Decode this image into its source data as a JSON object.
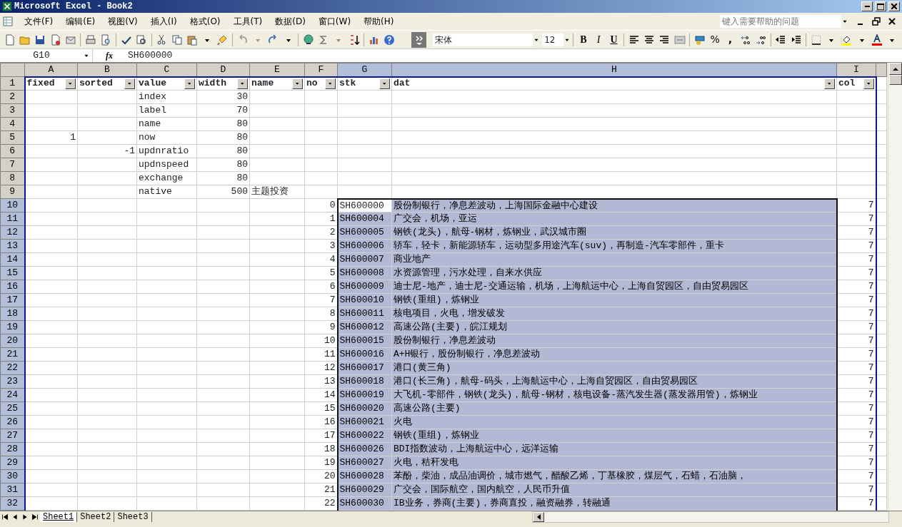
{
  "window": {
    "title": "Microsoft Excel - Book2"
  },
  "menu": [
    "文件(F)",
    "编辑(E)",
    "视图(V)",
    "插入(I)",
    "格式(O)",
    "工具(T)",
    "数据(D)",
    "窗口(W)",
    "帮助(H)"
  ],
  "help_box": {
    "placeholder": "键入需要帮助的问题"
  },
  "formatting": {
    "font": "宋体",
    "size": "12",
    "bold": "B",
    "italic": "I",
    "underline": "U",
    "percent": "%",
    "comma": ","
  },
  "formula_bar": {
    "name_box": "G10",
    "fx": "fx",
    "value": "SH600000"
  },
  "columns": [
    {
      "label": "A",
      "selected": false
    },
    {
      "label": "B",
      "selected": false
    },
    {
      "label": "C",
      "selected": false
    },
    {
      "label": "D",
      "selected": false
    },
    {
      "label": "E",
      "selected": false
    },
    {
      "label": "F",
      "selected": false
    },
    {
      "label": "G",
      "selected": true
    },
    {
      "label": "H",
      "selected": true
    },
    {
      "label": "I",
      "selected": false
    }
  ],
  "header_row": {
    "header": "1",
    "selected": false,
    "filters": [
      "fixed",
      "sorted",
      "value",
      "width",
      "name",
      "no",
      "stk",
      "dat",
      "col"
    ]
  },
  "rows": [
    {
      "header": "2",
      "selected": false,
      "cells": {
        "C": "index",
        "D": "30"
      }
    },
    {
      "header": "3",
      "selected": false,
      "cells": {
        "C": "label",
        "D": "70"
      }
    },
    {
      "header": "4",
      "selected": false,
      "cells": {
        "C": "name",
        "D": "80"
      }
    },
    {
      "header": "5",
      "selected": false,
      "cells": {
        "A": "1",
        "C": "now",
        "D": "80"
      }
    },
    {
      "header": "6",
      "selected": false,
      "cells": {
        "B": "-1",
        "C": "updnratio",
        "D": "80"
      }
    },
    {
      "header": "7",
      "selected": false,
      "cells": {
        "C": "updnspeed",
        "D": "80"
      }
    },
    {
      "header": "8",
      "selected": false,
      "cells": {
        "C": "exchange",
        "D": "80"
      }
    },
    {
      "header": "9",
      "selected": false,
      "cells": {
        "C": "native",
        "D": "500",
        "E": "主题投资"
      }
    },
    {
      "header": "10",
      "selected": true,
      "cells": {
        "F": "0",
        "G": "SH600000",
        "H": "股份制银行，净息差波动，上海国际金融中心建设",
        "I": "7"
      }
    },
    {
      "header": "11",
      "selected": true,
      "cells": {
        "F": "1",
        "G": "SH600004",
        "H": "广交会，机场，亚运",
        "I": "7"
      }
    },
    {
      "header": "12",
      "selected": true,
      "cells": {
        "F": "2",
        "G": "SH600005",
        "H": "钢铁(龙头)，航母-钢材，炼钢业，武汉城市圈",
        "I": "7"
      }
    },
    {
      "header": "13",
      "selected": true,
      "cells": {
        "F": "3",
        "G": "SH600006",
        "H": "轿车，轻卡，新能源轿车，运动型多用途汽车(suv)，再制造-汽车零部件，重卡",
        "I": "7"
      }
    },
    {
      "header": "14",
      "selected": true,
      "cells": {
        "F": "4",
        "G": "SH600007",
        "H": "商业地产",
        "I": "7"
      }
    },
    {
      "header": "15",
      "selected": true,
      "cells": {
        "F": "5",
        "G": "SH600008",
        "H": "水资源管理，污水处理，自来水供应",
        "I": "7"
      }
    },
    {
      "header": "16",
      "selected": true,
      "cells": {
        "F": "6",
        "G": "SH600009",
        "H": "迪士尼-地产，迪士尼-交通运输，机场，上海航运中心，上海自贸园区，自由贸易园区",
        "I": "7"
      }
    },
    {
      "header": "17",
      "selected": true,
      "cells": {
        "F": "7",
        "G": "SH600010",
        "H": "钢铁(重组)，炼钢业",
        "I": "7"
      }
    },
    {
      "header": "18",
      "selected": true,
      "cells": {
        "F": "8",
        "G": "SH600011",
        "H": "核电项目，火电，增发破发",
        "I": "7"
      }
    },
    {
      "header": "19",
      "selected": true,
      "cells": {
        "F": "9",
        "G": "SH600012",
        "H": "高速公路(主要)，皖江规划",
        "I": "7"
      }
    },
    {
      "header": "20",
      "selected": true,
      "cells": {
        "F": "10",
        "G": "SH600015",
        "H": "股份制银行，净息差波动",
        "I": "7"
      }
    },
    {
      "header": "21",
      "selected": true,
      "cells": {
        "F": "11",
        "G": "SH600016",
        "H": "A+H银行，股份制银行，净息差波动",
        "I": "7"
      }
    },
    {
      "header": "22",
      "selected": true,
      "cells": {
        "F": "12",
        "G": "SH600017",
        "H": "港口(黄三角)",
        "I": "7"
      }
    },
    {
      "header": "23",
      "selected": true,
      "cells": {
        "F": "13",
        "G": "SH600018",
        "H": "港口(长三角)，航母-码头，上海航运中心，上海自贸园区，自由贸易园区",
        "I": "7"
      }
    },
    {
      "header": "24",
      "selected": true,
      "cells": {
        "F": "14",
        "G": "SH600019",
        "H": "大飞机-零部件，钢铁(龙头)，航母-钢材，核电设备-蒸汽发生器(蒸发器用管)，炼钢业",
        "I": "7"
      }
    },
    {
      "header": "25",
      "selected": true,
      "cells": {
        "F": "15",
        "G": "SH600020",
        "H": "高速公路(主要)",
        "I": "7"
      }
    },
    {
      "header": "26",
      "selected": true,
      "cells": {
        "F": "16",
        "G": "SH600021",
        "H": "火电",
        "I": "7"
      }
    },
    {
      "header": "27",
      "selected": true,
      "cells": {
        "F": "17",
        "G": "SH600022",
        "H": "钢铁(重组)，炼钢业",
        "I": "7"
      }
    },
    {
      "header": "28",
      "selected": true,
      "cells": {
        "F": "18",
        "G": "SH600026",
        "H": "BDI指数波动，上海航运中心，远洋运输",
        "I": "7"
      }
    },
    {
      "header": "29",
      "selected": true,
      "cells": {
        "F": "19",
        "G": "SH600027",
        "H": "火电，秸秆发电",
        "I": "7"
      }
    },
    {
      "header": "30",
      "selected": true,
      "cells": {
        "F": "20",
        "G": "SH600028",
        "H": "苯酚，柴油，成品油调价，城市燃气，醋酸乙烯，丁基橡胶，煤层气，石蜡，石油脑，",
        "I": "7"
      }
    },
    {
      "header": "31",
      "selected": true,
      "cells": {
        "F": "21",
        "G": "SH600029",
        "H": "广交会，国际航空，国内航空，人民币升值",
        "I": "7"
      }
    },
    {
      "header": "32",
      "selected": true,
      "cells": {
        "F": "22",
        "G": "SH600030",
        "H": "IB业务，券商(主要)，券商直投，融资融券，转融通",
        "I": "7"
      }
    }
  ],
  "sheet_tabs": [
    {
      "label": "Sheet1",
      "selected": true
    },
    {
      "label": "Sheet2",
      "selected": false
    },
    {
      "label": "Sheet3",
      "selected": false
    }
  ]
}
